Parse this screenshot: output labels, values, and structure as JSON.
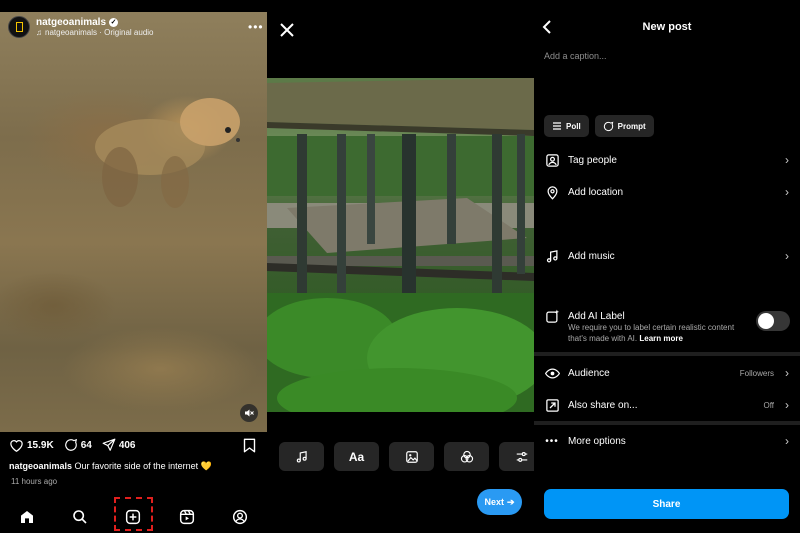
{
  "reel": {
    "username": "natgeoanimals",
    "audio": "natgeoanimals · Original audio",
    "likes": "15.9K",
    "comments": "64",
    "shares": "406",
    "caption_user": "natgeoanimals",
    "caption_text": "Our favorite side of the internet 💛",
    "time": "11 hours ago",
    "nav_icons": [
      "home-icon",
      "search-icon",
      "create-icon",
      "reels-icon",
      "profile-icon"
    ]
  },
  "editor": {
    "next_label": "Next",
    "tools": [
      "audio-icon",
      "text-icon",
      "sticker-icon",
      "filter-icon",
      "adjust-icon"
    ]
  },
  "new_post": {
    "title": "New post",
    "caption_placeholder": "Add a caption...",
    "poll_label": "Poll",
    "prompt_label": "Prompt",
    "tag_people": "Tag people",
    "add_location": "Add location",
    "add_music": "Add music",
    "ai_label_title": "Add AI Label",
    "ai_label_desc": "We require you to label certain realistic content that's made with AI.",
    "ai_learn_more": "Learn more",
    "ai_label_on": false,
    "audience": "Audience",
    "audience_value": "Followers",
    "also_share": "Also share on...",
    "also_share_value": "Off",
    "more_options": "More options",
    "share_label": "Share"
  },
  "colors": {
    "accent_blue": "#0095f6",
    "highlight_red": "#e0201e",
    "heart_yellow": "#f5c400"
  }
}
